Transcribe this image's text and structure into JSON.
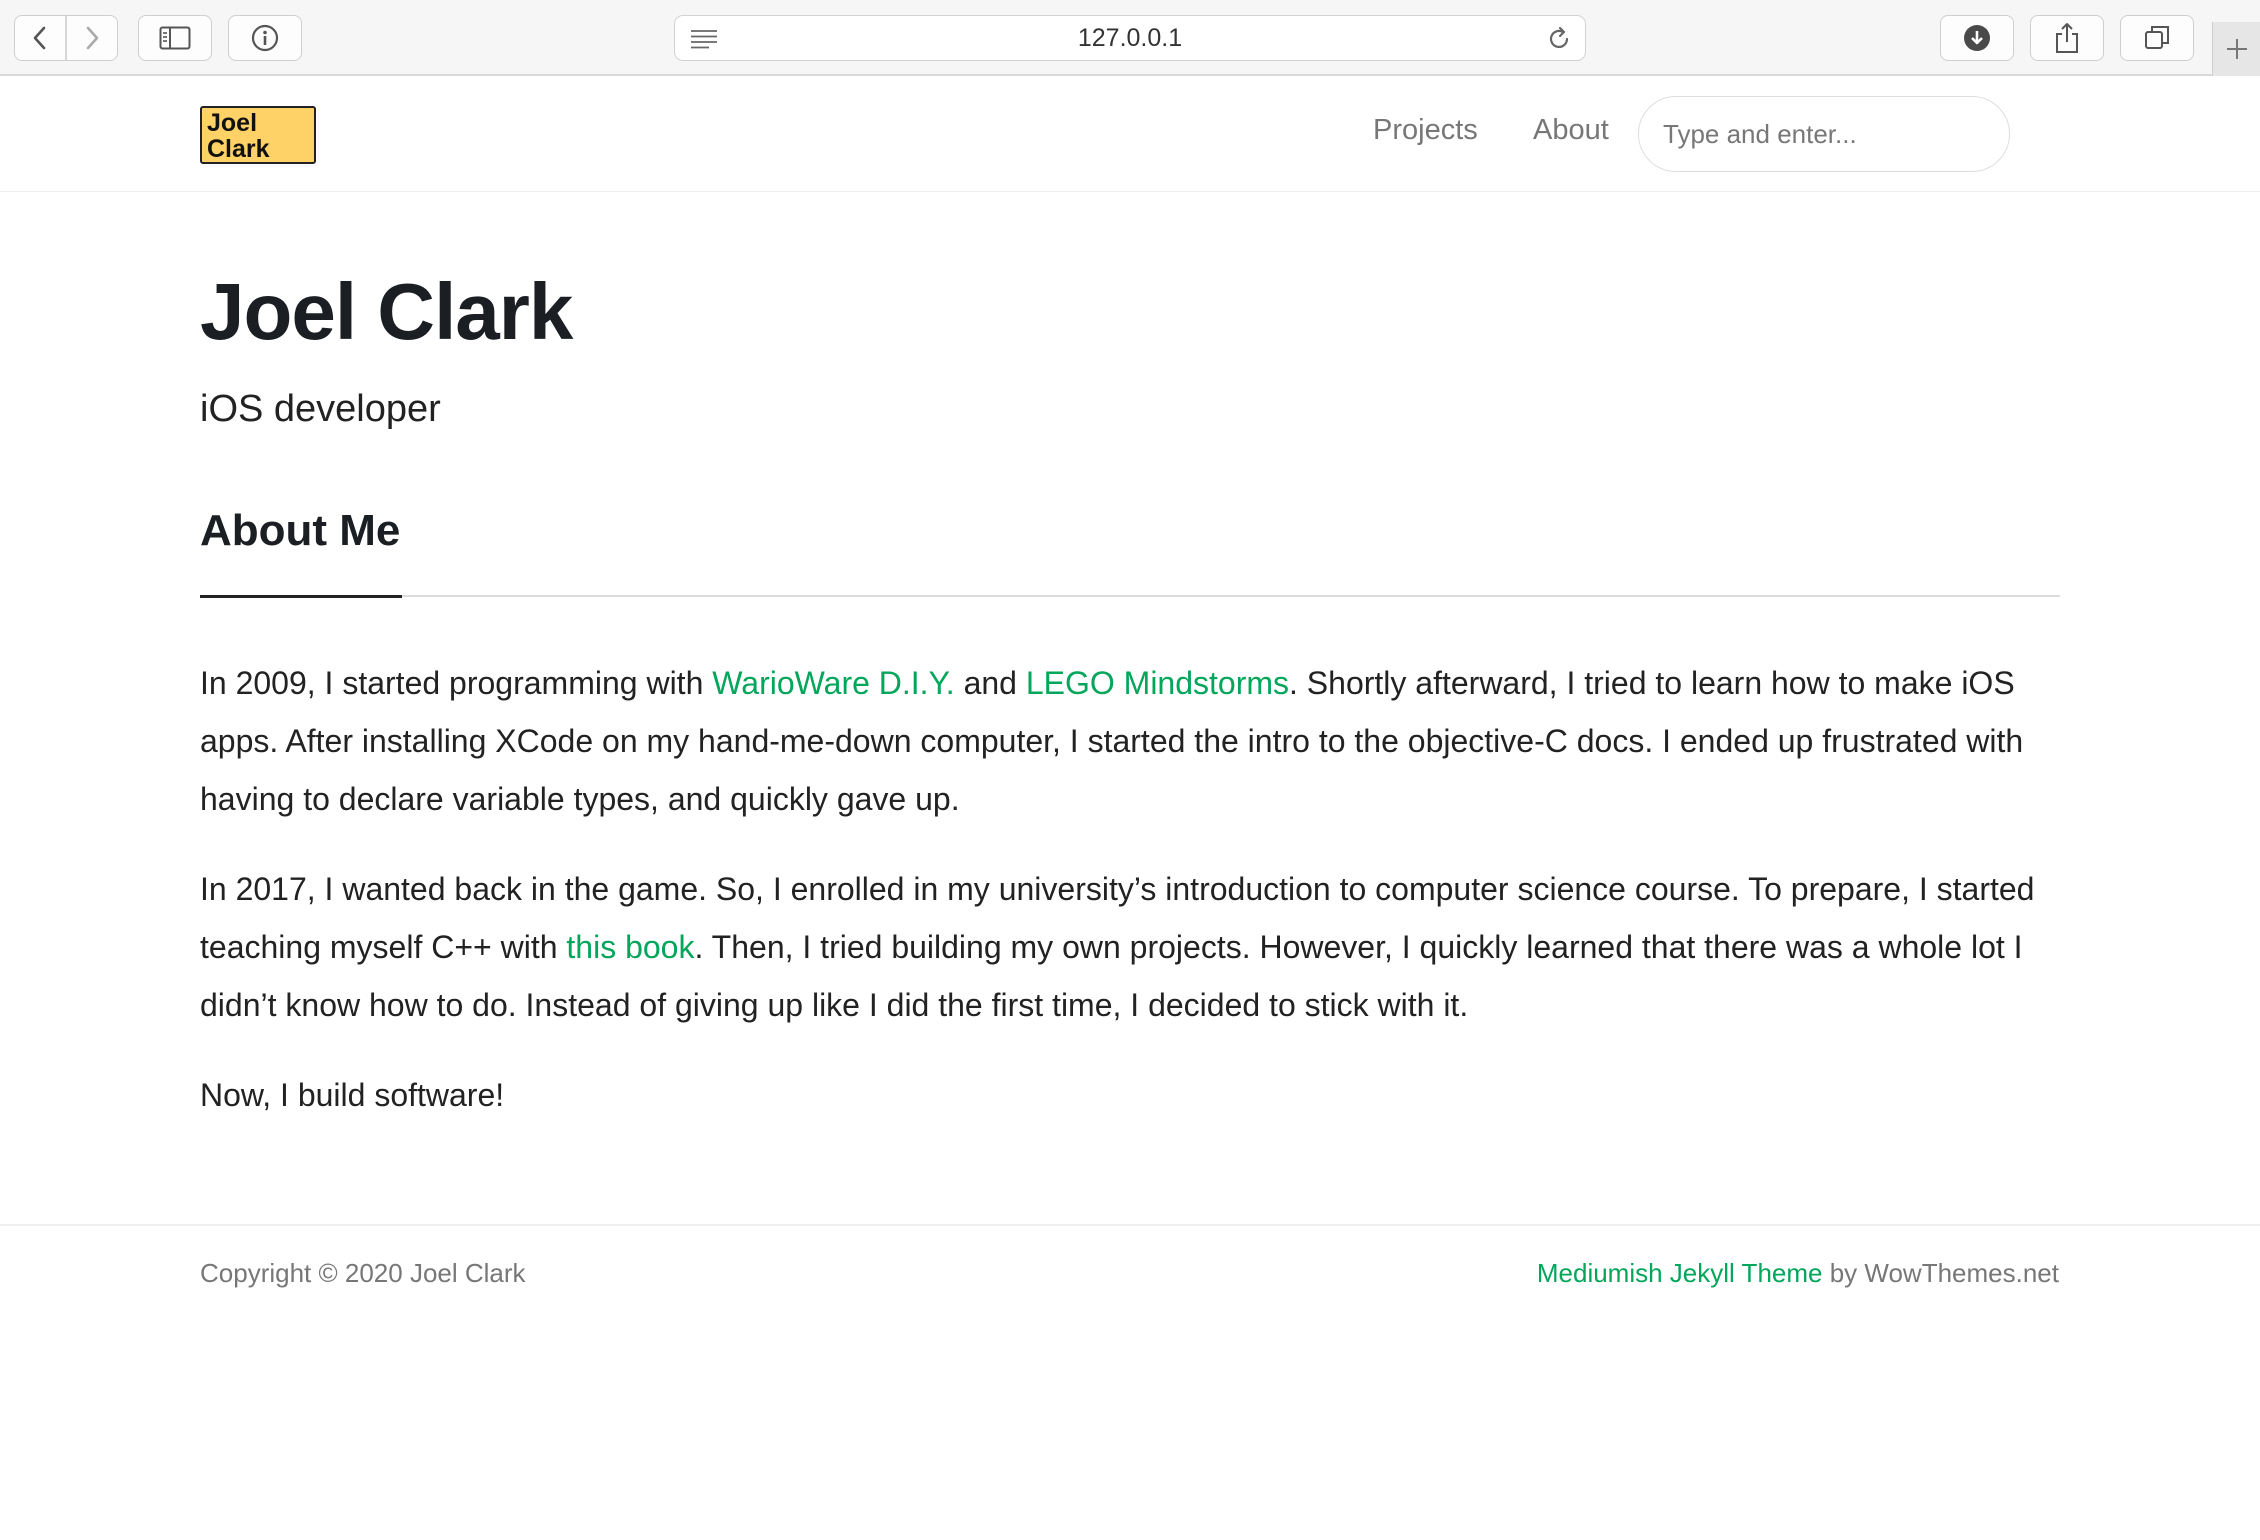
{
  "browser": {
    "url": "127.0.0.1"
  },
  "header": {
    "logo_line1": "Joel",
    "logo_line2": "Clark",
    "nav": [
      "Projects",
      "About"
    ],
    "search_placeholder": "Type and enter..."
  },
  "hero": {
    "title": "Joel Clark",
    "tagline": "iOS developer"
  },
  "about": {
    "heading": "About Me",
    "p1": {
      "t1": "In 2009, I started programming with ",
      "link1": "WarioWare D.I.Y.",
      "t2": " and ",
      "link2": "LEGO Mindstorms",
      "t3": ". Shortly afterward, I tried to learn how to make iOS apps. After installing XCode on my hand-me-down computer, I started the intro to the objective-C docs. I ended up frustrated with having to declare variable types, and quickly gave up."
    },
    "p2": {
      "t1": "In 2017, I wanted back in the game. So, I enrolled in my university’s introduction to computer science course. To prepare, I started teaching myself C++ with ",
      "link": "this book",
      "t2": ". Then, I tried building my own projects. However, I quickly learned that there was a whole lot I didn’t know how to do. Instead of giving up like I did the first time, I decided to stick with it."
    },
    "p3": "Now, I build software!"
  },
  "footer": {
    "copyright": "Copyright © 2020 Joel Clark",
    "theme_link": "Mediumish Jekyll Theme",
    "by_text": " by WowThemes.net"
  },
  "colors": {
    "link": "#03a65a",
    "logo_bg": "#ffd267"
  }
}
